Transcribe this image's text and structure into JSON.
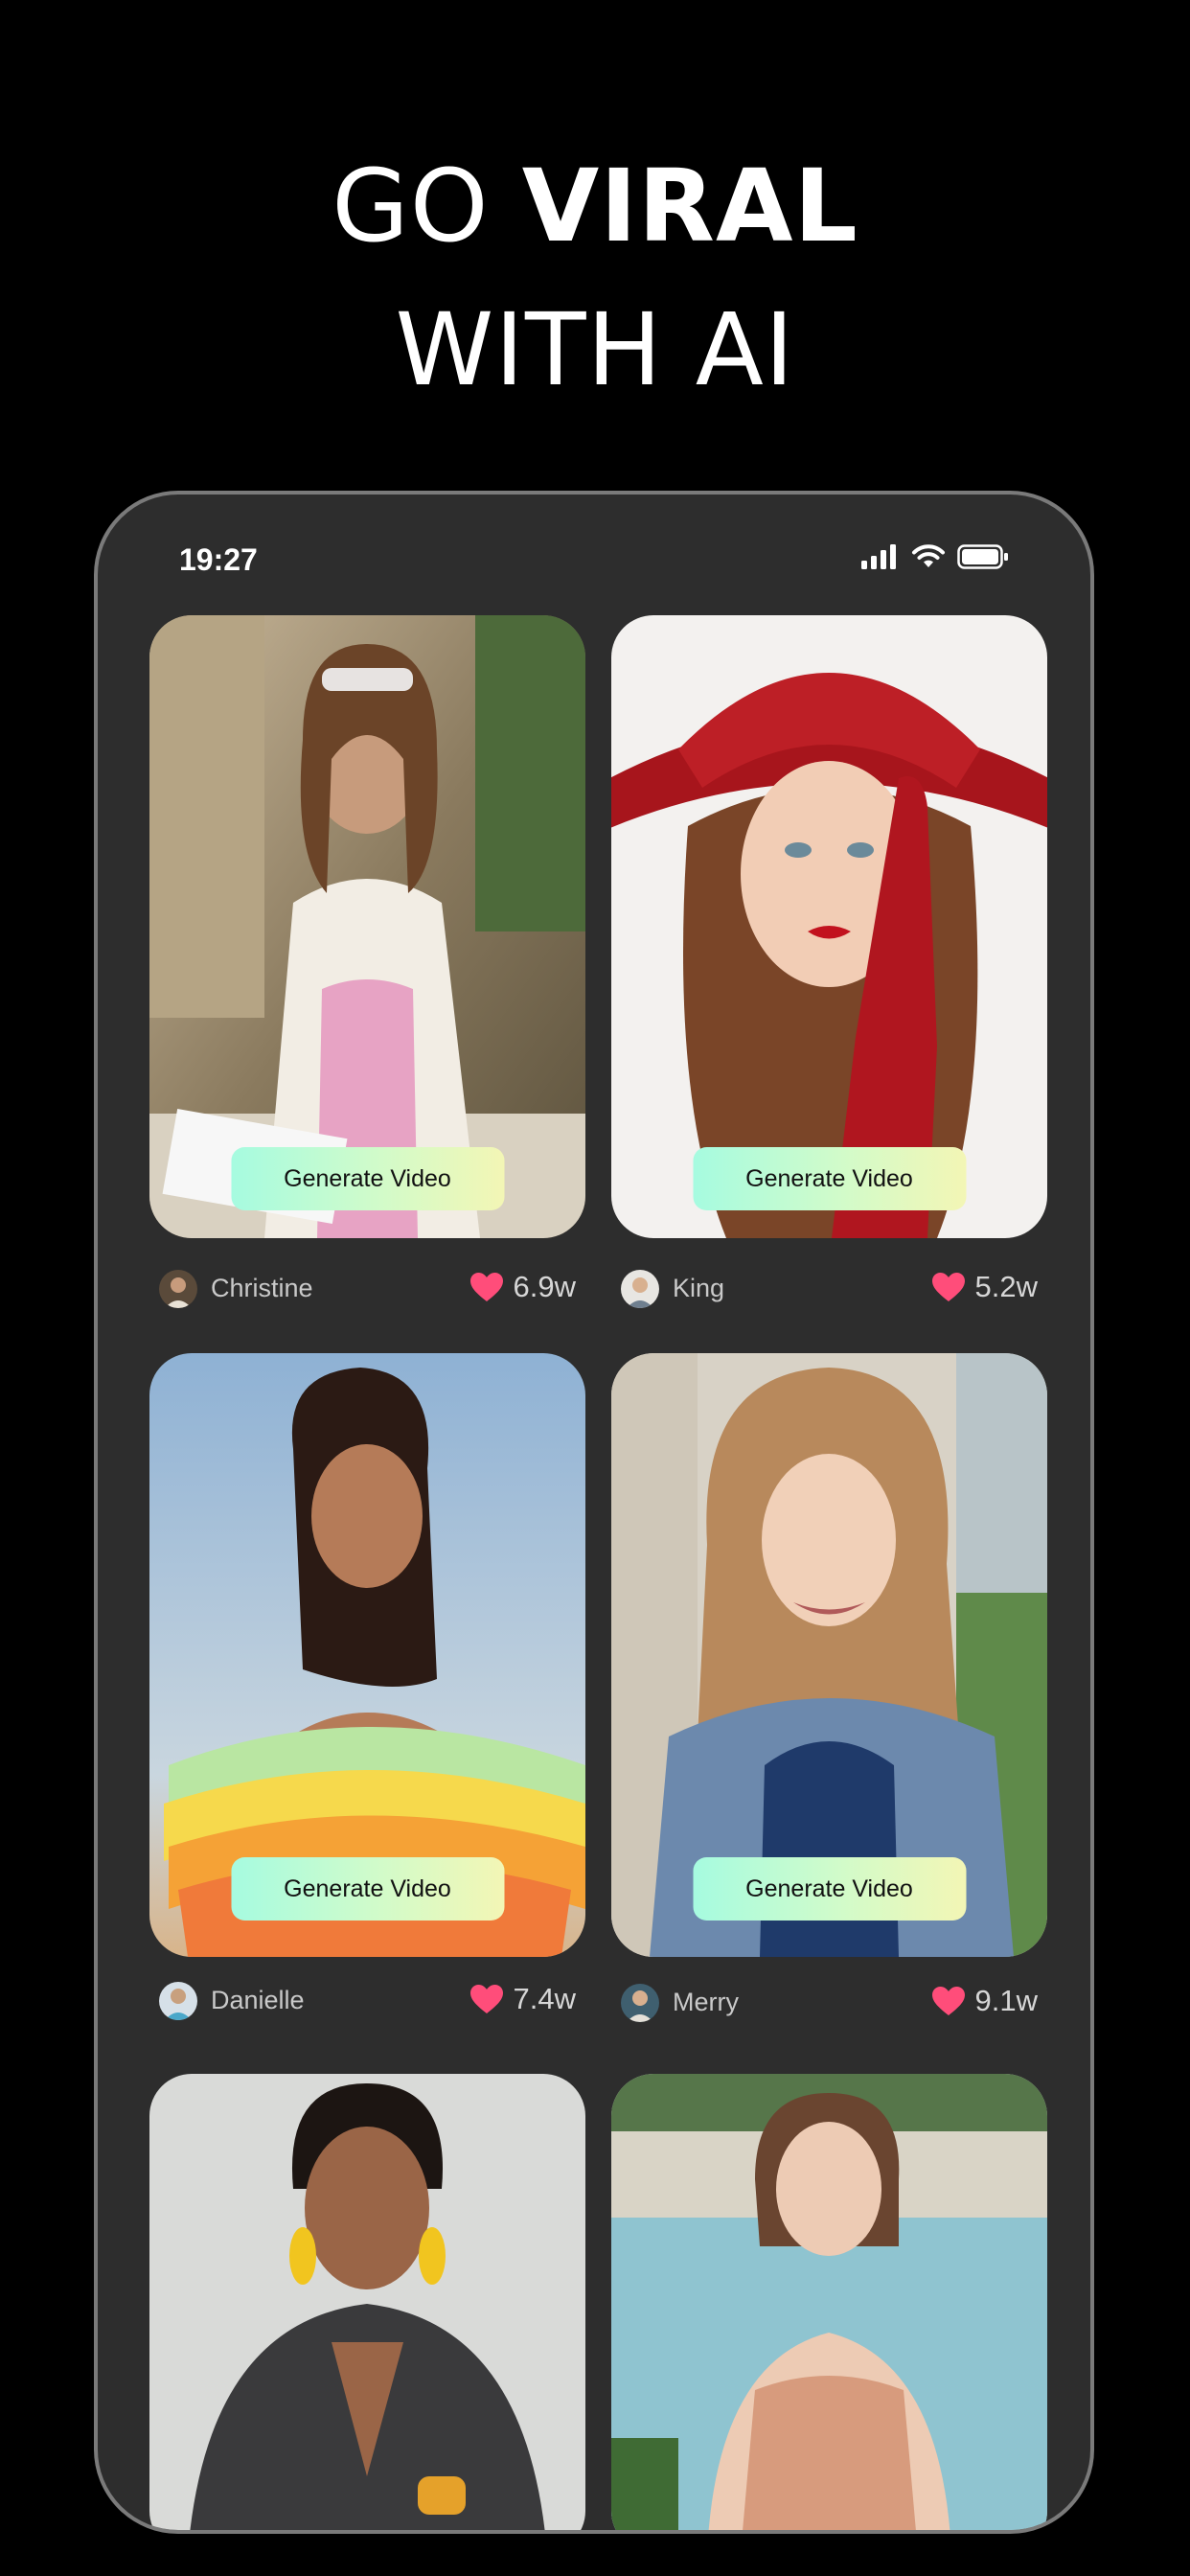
{
  "headline": {
    "line1_light": "GO ",
    "line1_bold": "VIRAL",
    "line2": "WITH AI"
  },
  "status_bar": {
    "time": "19:27",
    "icons": [
      "signal-icon",
      "wifi-icon",
      "battery-icon"
    ]
  },
  "colors": {
    "background": "#000000",
    "phone_frame": "#7a7a7a",
    "phone_screen": "#2d2d2d",
    "button_gradient_start": "#a6fbe0",
    "button_gradient_end": "#f3f6b5",
    "heart": "#ff4d7a"
  },
  "cards": [
    {
      "name": "Christine",
      "likes": "6.9w",
      "button_label": "Generate Video"
    },
    {
      "name": "King",
      "likes": "5.2w",
      "button_label": "Generate Video"
    },
    {
      "name": "Danielle",
      "likes": "7.4w",
      "button_label": "Generate Video"
    },
    {
      "name": "Merry",
      "likes": "9.1w",
      "button_label": "Generate Video"
    },
    {
      "name": "",
      "likes": "",
      "button_label": ""
    },
    {
      "name": "",
      "likes": "",
      "button_label": ""
    }
  ]
}
